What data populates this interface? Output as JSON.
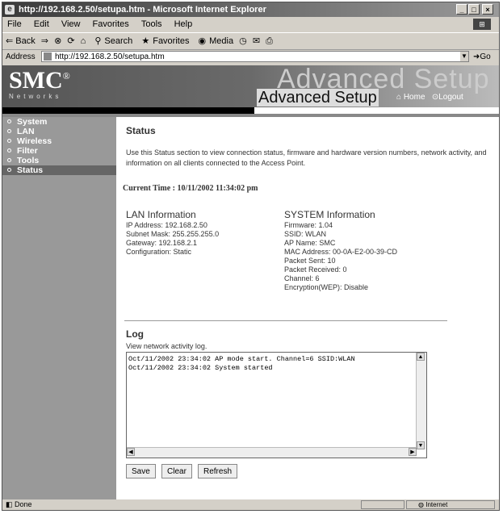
{
  "window": {
    "title": "http://192.168.2.50/setupa.htm - Microsoft Internet Explorer",
    "controls": [
      "_",
      "□",
      "×"
    ]
  },
  "menu": [
    "File",
    "Edit",
    "View",
    "Favorites",
    "Tools",
    "Help"
  ],
  "toolbar": {
    "back": "⇐ Back",
    "forward": "⇒",
    "search": "Search",
    "favorites": "Favorites",
    "media": "Media"
  },
  "address": {
    "label": "Address",
    "url": "http://192.168.2.50/setupa.htm",
    "go": "Go"
  },
  "banner": {
    "brand": "SMC",
    "brand_mark": "®",
    "brand_sub": "Networks",
    "watermark": "Advanced Setup",
    "heading": "Advanced Setup",
    "home": "Home",
    "logout": "Logout"
  },
  "sidebar": {
    "items": [
      {
        "label": "System"
      },
      {
        "label": "LAN"
      },
      {
        "label": "Wireless"
      },
      {
        "label": "Filter"
      },
      {
        "label": "Tools"
      },
      {
        "label": "Status",
        "selected": true
      }
    ]
  },
  "status": {
    "heading": "Status",
    "description": "Use this Status section to view connection status, firmware and hardware version numbers, network activity, and information on all clients connected to the Access Point.",
    "current_time": "Current Time :  10/11/2002 11:34:02 pm"
  },
  "lan": {
    "heading": "LAN Information",
    "rows": [
      "IP Address:  192.168.2.50",
      "Subnet Mask:  255.255.255.0",
      "Gateway:  192.168.2.1",
      "Configuration:   Static"
    ]
  },
  "system": {
    "heading": "SYSTEM Information",
    "rows": [
      "Firmware:  1.04",
      "SSID:  WLAN",
      "AP Name:  SMC",
      "MAC Address:  00-0A-E2-00-39-CD",
      "Packet Sent:  10",
      "Packet Received:  0",
      "Channel:  6",
      "Encryption(WEP):   Disable"
    ]
  },
  "log": {
    "heading": "Log",
    "subtitle": "View network activity log.",
    "lines": [
      "Oct/11/2002 23:34:02 AP mode start. Channel=6 SSID:WLAN",
      "Oct/11/2002 23:34:02 System started"
    ],
    "buttons": {
      "save": "Save",
      "clear": "Clear",
      "refresh": "Refresh"
    }
  },
  "statusbar": {
    "left": "Done",
    "zone": "Internet"
  }
}
